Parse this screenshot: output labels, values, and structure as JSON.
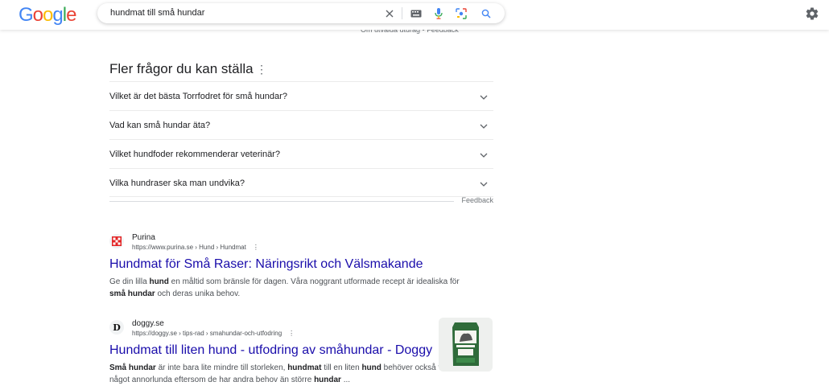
{
  "header": {
    "logo_letters": [
      {
        "ch": "G",
        "color": "#4285F4"
      },
      {
        "ch": "o",
        "color": "#EA4335"
      },
      {
        "ch": "o",
        "color": "#FBBC05"
      },
      {
        "ch": "g",
        "color": "#4285F4"
      },
      {
        "ch": "l",
        "color": "#34A853"
      },
      {
        "ch": "e",
        "color": "#EA4335"
      }
    ],
    "query": "hundmat till små hundar"
  },
  "top_sliver": {
    "meta": "Om utvalda utdrag  •   Feedback"
  },
  "paa": {
    "title": "Fler frågor du kan ställa",
    "questions": [
      "Vilket är det bästa Torrfodret för små hundar?",
      "Vad kan små hundar äta?",
      "Vilket hundfoder rekommenderar veterinär?",
      "Vilka hundraser ska man undvika?"
    ],
    "feedback": "Feedback"
  },
  "results": [
    {
      "site": "Purina",
      "url": "https://www.purina.se › Hund › Hundmat",
      "title": "Hundmat för Små Raser: Näringsrikt och Välsmakande",
      "snippet_parts": [
        {
          "t": "Ge din lilla ",
          "b": false
        },
        {
          "t": "hund",
          "b": true
        },
        {
          "t": " en måltid som bränsle för dagen. Våra noggrant utformade recept är idealiska för ",
          "b": false
        },
        {
          "t": "små hundar",
          "b": true
        },
        {
          "t": " och deras unika behov.",
          "b": false
        }
      ]
    },
    {
      "site": "doggy.se",
      "url": "https://doggy.se › tips-rad › smahundar-och-utfodring",
      "title": "Hundmat till liten hund - utfodring av småhundar - Doggy",
      "snippet_parts": [
        {
          "t": "Små hundar",
          "b": true
        },
        {
          "t": " är inte bara lite mindre till storleken, ",
          "b": false
        },
        {
          "t": "hundmat",
          "b": true
        },
        {
          "t": " till en liten ",
          "b": false
        },
        {
          "t": "hund",
          "b": true
        },
        {
          "t": " behöver också vara något annorlunda eftersom de har andra behov än större ",
          "b": false
        },
        {
          "t": "hundar",
          "b": true
        },
        {
          "t": " ...",
          "b": false
        }
      ]
    }
  ],
  "colors": {
    "link": "#1a0dab",
    "text": "#202124",
    "muted": "#70757a"
  }
}
